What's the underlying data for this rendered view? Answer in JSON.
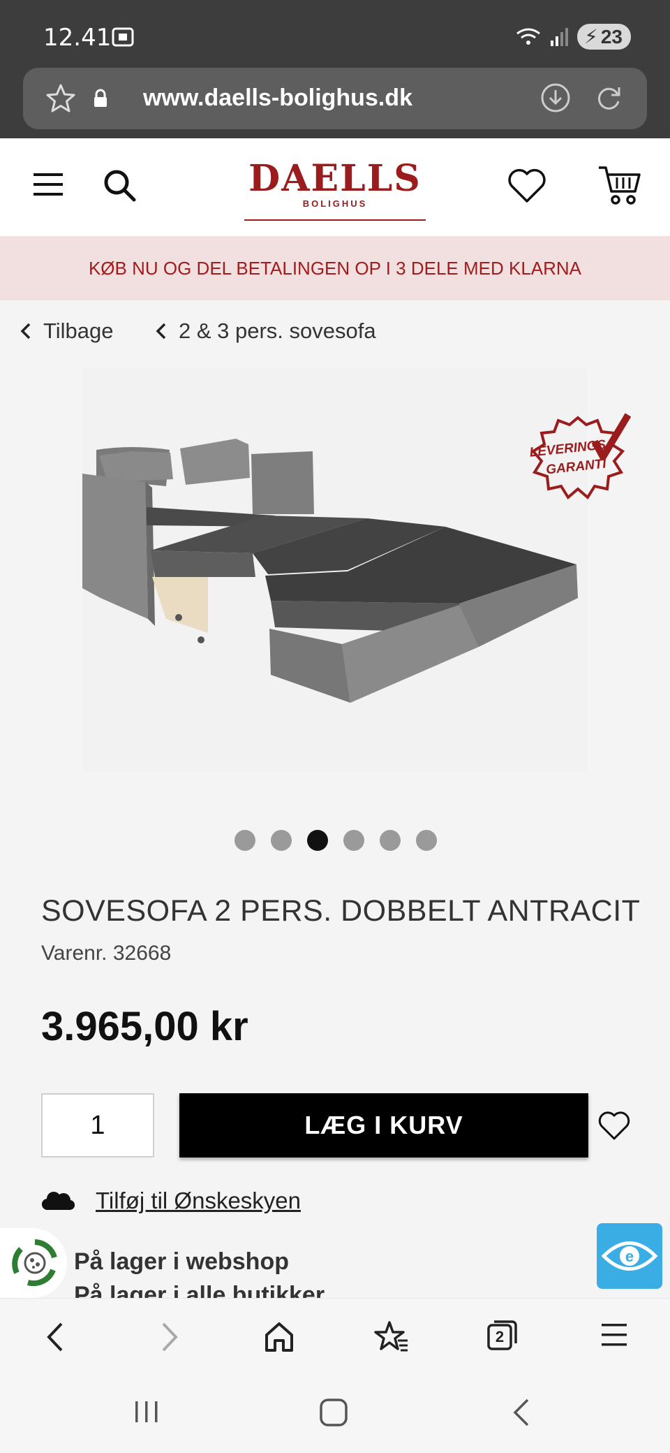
{
  "status": {
    "time": "12.41",
    "battery": "23"
  },
  "browser": {
    "url": "www.daells-bolighus.dk"
  },
  "header": {
    "logo_main": "DAELLS",
    "logo_sub": "BOLIGHUS"
  },
  "promo": {
    "text": "KØB NU OG DEL BETALINGEN OP I 3 DELE MED KLARNA"
  },
  "breadcrumb": {
    "back": "Tilbage",
    "category": "2 & 3 pers. sovesofa"
  },
  "badge": {
    "line1": "LEVERINGS",
    "line2": "GARANTI"
  },
  "gallery": {
    "count": 6,
    "active_index": 2
  },
  "product": {
    "title": "SOVESOFA 2 PERS. DOBBELT ANTRACIT",
    "sku": "Varenr. 32668",
    "price": "3.965,00 kr",
    "quantity": "1",
    "add_to_cart": "LÆG I KURV",
    "wishlist_link": "Tilføj til Ønskeskyen",
    "stock_webshop": "På lager i webshop",
    "stock_stores": "På lager i alle butikker"
  },
  "colors": {
    "brand": "#9b1c1c",
    "promo_bg": "#f2e0e0",
    "accessibility": "#3aaee4"
  },
  "icons": [
    "star-icon",
    "lock-icon",
    "download-icon",
    "reload-icon",
    "menu-icon",
    "search-icon",
    "heart-icon",
    "cart-icon",
    "chevron-left-icon",
    "cloud-icon",
    "recycle-icon",
    "eye-icon",
    "back-icon",
    "forward-icon",
    "home-icon",
    "bookmarks-icon",
    "tabs-icon"
  ],
  "toolbar": {
    "tabs_count": "2"
  }
}
